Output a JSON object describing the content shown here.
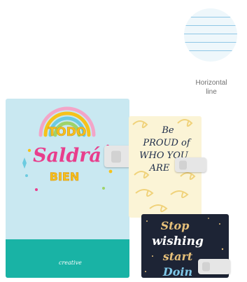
{
  "swatch": {
    "caption_line1": "Horizontal",
    "caption_line2": "line",
    "line_color": "#8fc7e6",
    "fill_color": "#eef7fb"
  },
  "notebooks": [
    {
      "design": "todo-saldra-bien",
      "lines": [
        "TODO",
        "Saldrá",
        "BIEN"
      ],
      "brand": "creative",
      "colors": {
        "cover": "#c9e8f1",
        "band": "#19b3a5",
        "pink": "#e83e8c",
        "yellow": "#f6c21b"
      }
    },
    {
      "design": "be-proud-of-who-you-are",
      "lines": [
        "Be",
        "PROUD of",
        "WHO YOU",
        "ARE"
      ],
      "colors": {
        "cover": "#fbf4d6",
        "swirl": "#f0d27a",
        "ink": "#1b2a48"
      }
    },
    {
      "design": "stop-wishing-start-doing",
      "lines": [
        "Stop",
        "wishing",
        "start",
        "Doin"
      ],
      "colors": {
        "cover": "#1d2435",
        "script": "#e6c07a",
        "accent": "#7fc8e8"
      }
    }
  ]
}
